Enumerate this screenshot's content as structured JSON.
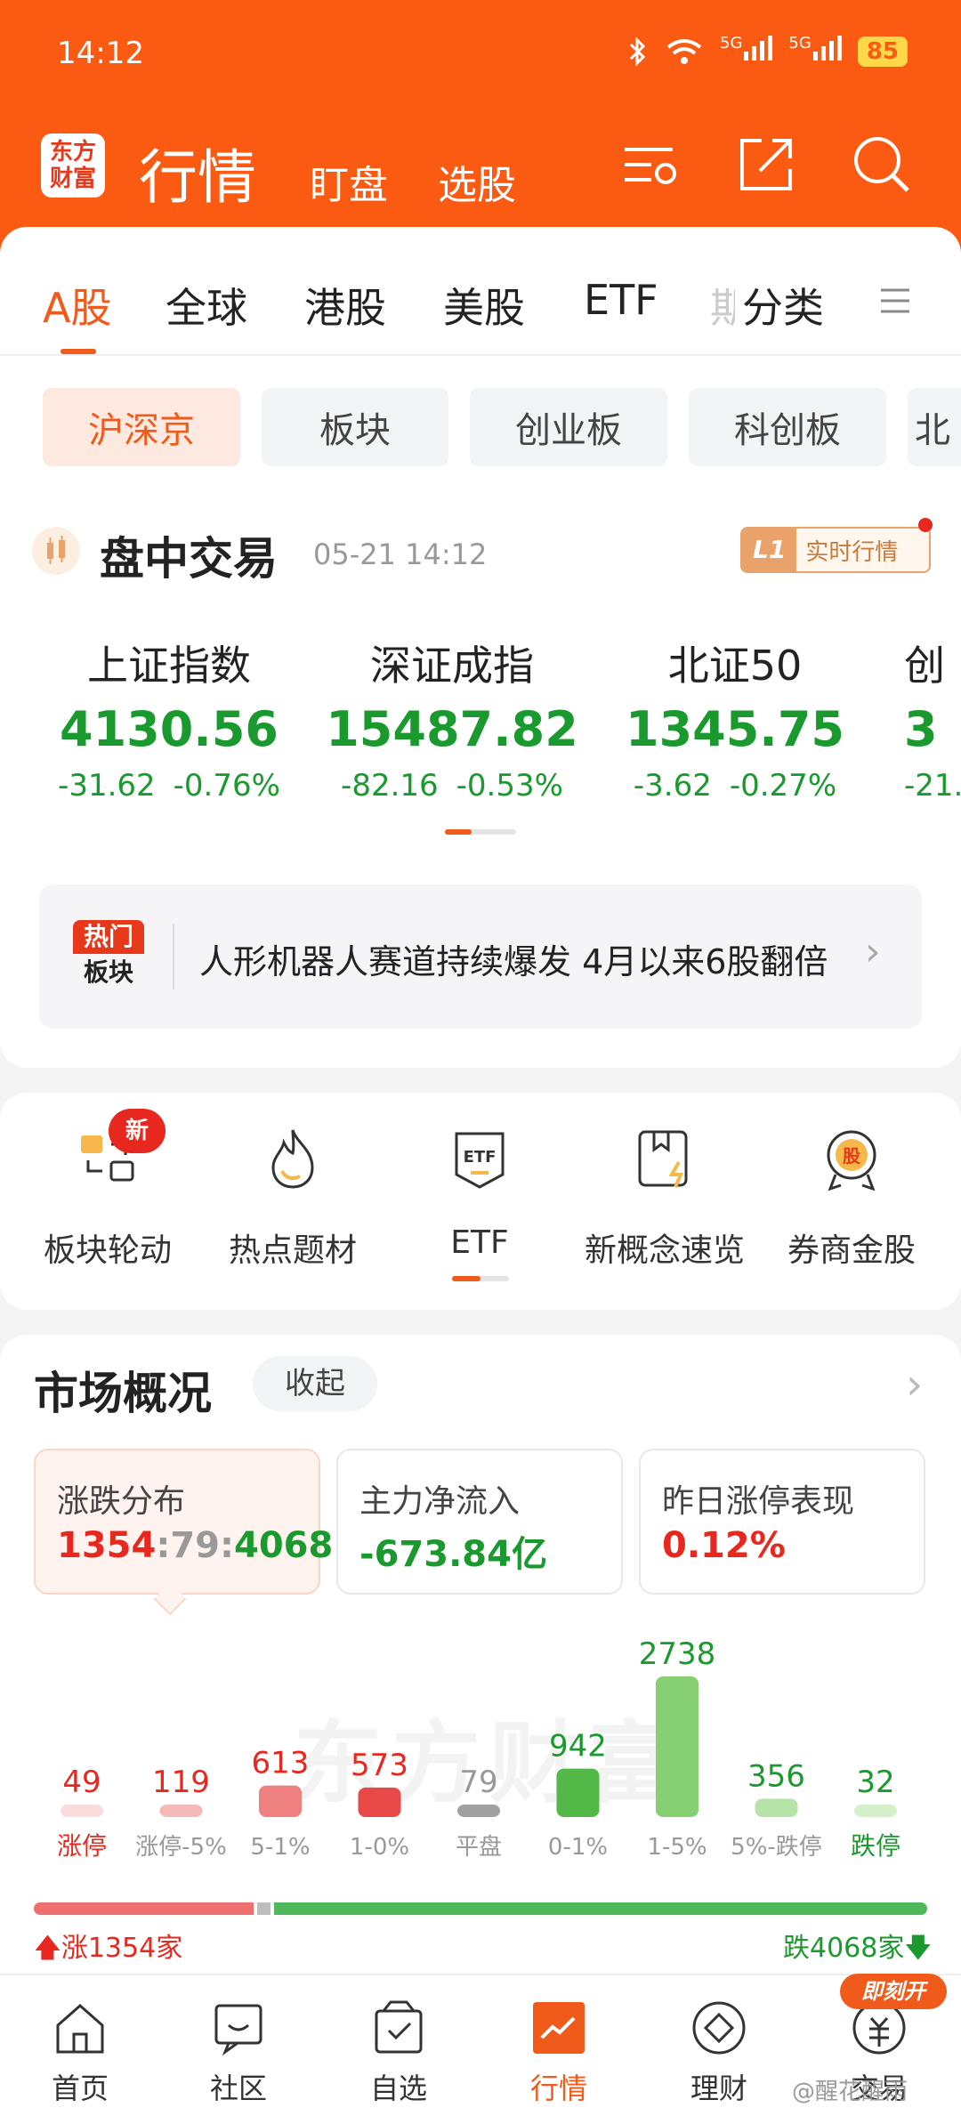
{
  "status": {
    "time": "14:12",
    "battery": "85",
    "net1": "5G",
    "net2": "5G"
  },
  "header": {
    "logo": "东方财富",
    "title": "行情",
    "sub1": "盯盘",
    "sub2": "选股"
  },
  "tabs": [
    "A股",
    "全球",
    "港股",
    "美股",
    "ETF",
    "期",
    "分类"
  ],
  "pills": [
    "沪深京",
    "板块",
    "创业板",
    "科创板",
    "北"
  ],
  "trading": {
    "title": "盘中交易",
    "time": "05-21 14:12",
    "badge_l1": "L1",
    "badge_text": "实时行情"
  },
  "indices": [
    {
      "name": "上证指数",
      "value": "4130.56",
      "chg": "-31.62",
      "pct": "-0.76%"
    },
    {
      "name": "深证成指",
      "value": "15487.82",
      "chg": "-82.16",
      "pct": "-0.53%"
    },
    {
      "name": "北证50",
      "value": "1345.75",
      "chg": "-3.62",
      "pct": "-0.27%"
    },
    {
      "name": "创",
      "value": "3",
      "chg": "-21.",
      "pct": ""
    }
  ],
  "hot": {
    "badge1": "热门",
    "badge2": "板块",
    "text": "人形机器人赛道持续爆发 4月以来6股翻倍"
  },
  "tools": [
    {
      "label": "板块轮动",
      "icon": "rotation-icon",
      "badge": "新"
    },
    {
      "label": "热点题材",
      "icon": "flame-icon"
    },
    {
      "label": "ETF",
      "icon": "etf-icon"
    },
    {
      "label": "新概念速览",
      "icon": "concept-icon"
    },
    {
      "label": "券商金股",
      "icon": "gold-stock-icon"
    }
  ],
  "market": {
    "title": "市场概况",
    "collapse": "收起",
    "stats": [
      {
        "label": "涨跌分布",
        "up": "1354",
        "flat": "79",
        "down": "4068"
      },
      {
        "label": "主力净流入",
        "value": "-673.84亿"
      },
      {
        "label": "昨日涨停表现",
        "value": "0.12%"
      }
    ],
    "watermark": "东方财富"
  },
  "chart_data": {
    "type": "bar",
    "categories": [
      "涨停",
      "涨停-5%",
      "5-1%",
      "1-0%",
      "平盘",
      "0-1%",
      "1-5%",
      "5%-跌停",
      "跌停"
    ],
    "values": [
      49,
      119,
      613,
      573,
      79,
      942,
      2738,
      356,
      32
    ],
    "colors": [
      "#fadcdc",
      "#f6b9b9",
      "#ef8080",
      "#e84848",
      "#a0a0a0",
      "#52b848",
      "#86cf72",
      "#b6e3a8",
      "#d6f0cc"
    ],
    "label_colors": [
      "#e8281e",
      "#e8281e",
      "#e8281e",
      "#e8281e",
      "#999999",
      "#1a9a2e",
      "#1a9a2e",
      "#1a9a2e",
      "#1a9a2e"
    ],
    "ratio": {
      "up": 1354,
      "flat": 79,
      "down": 4068
    },
    "up_label": "涨1354家",
    "down_label": "跌4068家"
  },
  "tabbar": [
    {
      "label": "首页",
      "icon": "home-icon"
    },
    {
      "label": "社区",
      "icon": "community-icon"
    },
    {
      "label": "自选",
      "icon": "watchlist-icon"
    },
    {
      "label": "行情",
      "icon": "market-icon",
      "active": true
    },
    {
      "label": "理财",
      "icon": "wealth-icon"
    },
    {
      "label": "交易",
      "icon": "trade-icon"
    }
  ],
  "promo_badge": "即刻开",
  "credit": "@醒花醒雨",
  "colors": {
    "brand": "#fb5a12",
    "accent": "#f05a1a",
    "up": "#e8281e",
    "down": "#1a9a2e"
  }
}
